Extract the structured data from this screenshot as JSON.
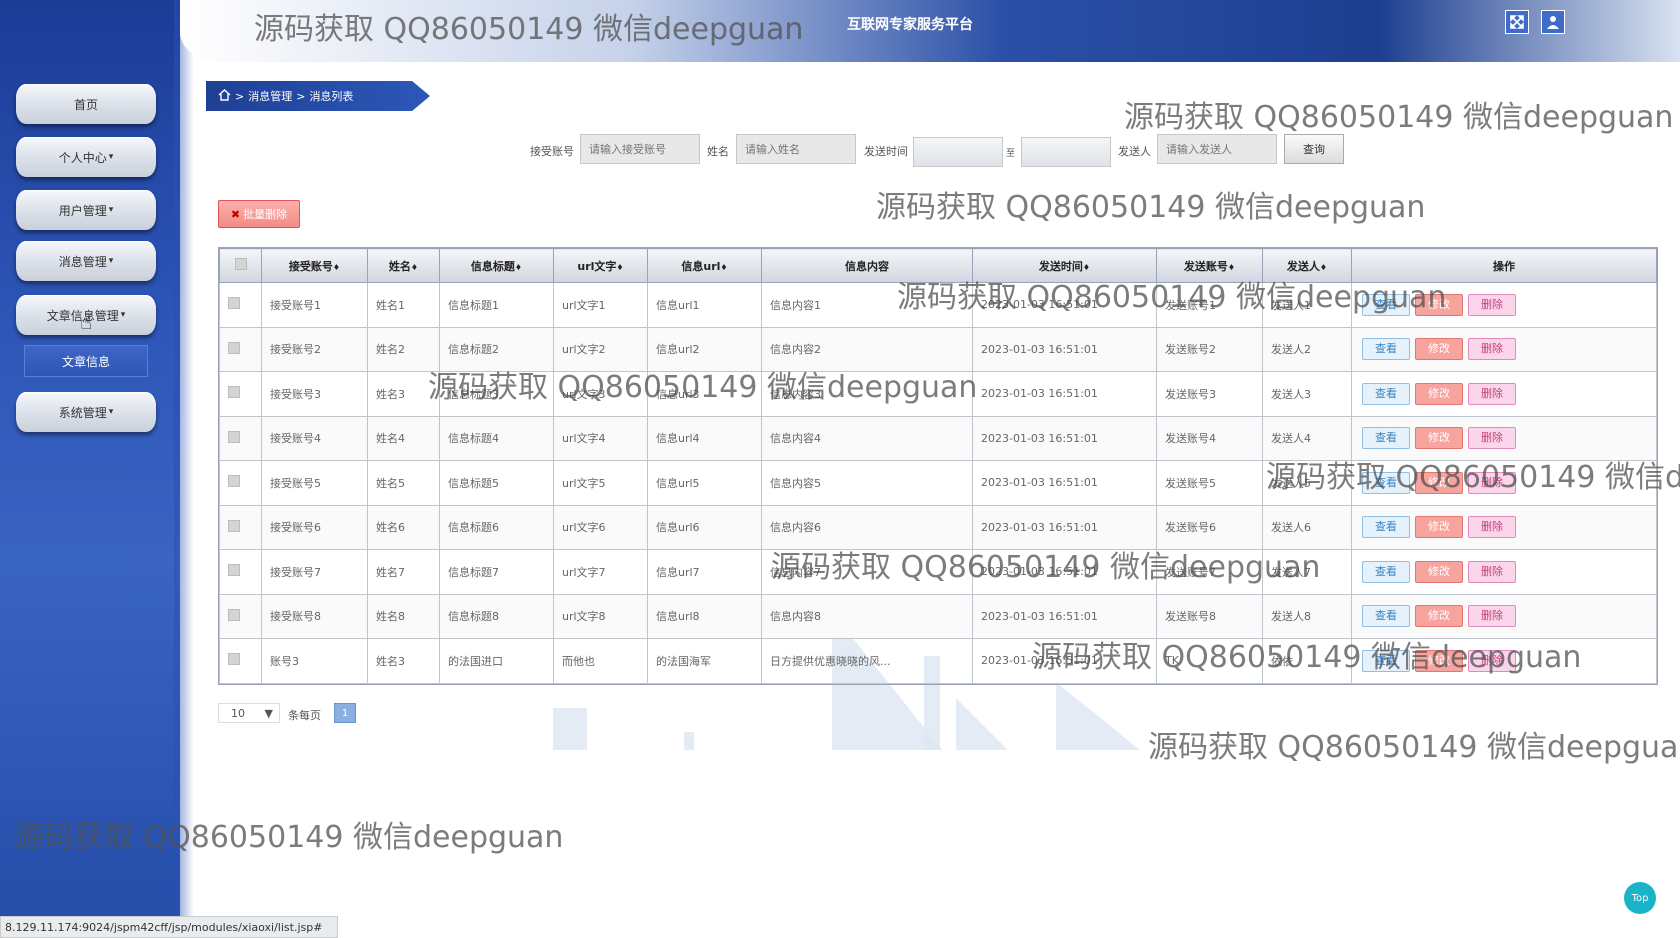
{
  "header": {
    "title": "互联网专家服务平台"
  },
  "sidebar": {
    "items": [
      {
        "label": "首页"
      },
      {
        "label": "个人中心"
      },
      {
        "label": "用户管理"
      },
      {
        "label": "消息管理"
      },
      {
        "label": "文章信息管理"
      },
      {
        "label": "系统管理"
      }
    ],
    "sub_item": "文章信息",
    "caret": "▾"
  },
  "breadcrumb": {
    "sep": ">",
    "level1": "消息管理",
    "level2": "消息列表"
  },
  "search": {
    "account_label": "接受账号",
    "account_placeholder": "请输入接受账号",
    "name_label": "姓名",
    "name_placeholder": "请输入姓名",
    "time_label": "发送时间",
    "time_sep": "至",
    "sender_label": "发送人",
    "sender_placeholder": "请输入发送人",
    "query_button": "查询"
  },
  "toolbar": {
    "batch_delete": "批量删除"
  },
  "table": {
    "headers": [
      "接受账号",
      "姓名",
      "信息标题",
      "url文字",
      "信息url",
      "信息内容",
      "发送时间",
      "发送账号",
      "发送人",
      "操作"
    ],
    "sortable_mark": "♦",
    "actions": {
      "view": "查看",
      "edit": "修改",
      "delete": "删除"
    },
    "rows": [
      [
        "接受账号1",
        "姓名1",
        "信息标题1",
        "url文字1",
        "信息url1",
        "信息内容1",
        "2023-01-03 16:51:01",
        "发送账号1",
        "发送人1"
      ],
      [
        "接受账号2",
        "姓名2",
        "信息标题2",
        "url文字2",
        "信息url2",
        "信息内容2",
        "2023-01-03 16:51:01",
        "发送账号2",
        "发送人2"
      ],
      [
        "接受账号3",
        "姓名3",
        "信息标题3",
        "url文字3",
        "信息url3",
        "信息内容3",
        "2023-01-03 16:51:01",
        "发送账号3",
        "发送人3"
      ],
      [
        "接受账号4",
        "姓名4",
        "信息标题4",
        "url文字4",
        "信息url4",
        "信息内容4",
        "2023-01-03 16:51:01",
        "发送账号4",
        "发送人4"
      ],
      [
        "接受账号5",
        "姓名5",
        "信息标题5",
        "url文字5",
        "信息url5",
        "信息内容5",
        "2023-01-03 16:51:01",
        "发送账号5",
        "发送人5"
      ],
      [
        "接受账号6",
        "姓名6",
        "信息标题6",
        "url文字6",
        "信息url6",
        "信息内容6",
        "2023-01-03 16:51:01",
        "发送账号6",
        "发送人6"
      ],
      [
        "接受账号7",
        "姓名7",
        "信息标题7",
        "url文字7",
        "信息url7",
        "信息内容7",
        "2023-01-03 16:51:01",
        "发送账号7",
        "发送人7"
      ],
      [
        "接受账号8",
        "姓名8",
        "信息标题8",
        "url文字8",
        "信息url8",
        "信息内容8",
        "2023-01-03 16:51:01",
        "发送账号8",
        "发送人8"
      ],
      [
        "账号3",
        "姓名3",
        "的法国进口",
        "而他也",
        "的法国海军",
        "日方提供优惠晓晓的风...",
        "2023-01-03 16:51:01",
        "TK",
        "依依"
      ]
    ]
  },
  "pagination": {
    "page_size": "10",
    "per_page_label": "条每页",
    "current_page": "1"
  },
  "top_button": "Top",
  "status_bar": "8.129.11.174:9024/jspm42cff/jsp/modules/xiaoxi/list.jsp#",
  "watermark": "源码获取 QQ86050149 微信deepguan",
  "colors": {
    "primary": "#2a4fa6",
    "sidebar": "#2d56b8",
    "edit": "#f7a49f",
    "delete": "#fbd6ea",
    "view": "#e6f2fb"
  }
}
